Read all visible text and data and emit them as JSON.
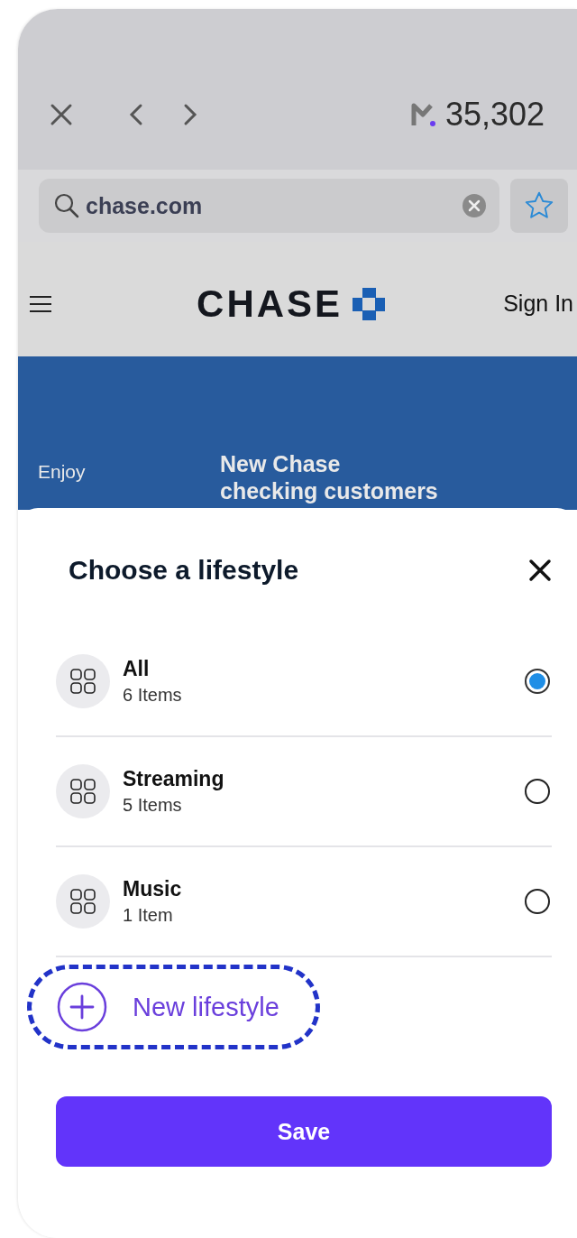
{
  "browser": {
    "points": "35,302",
    "address": "chase.com",
    "bookmarked": false
  },
  "site": {
    "logo": "CHASE",
    "sign_in": "Sign In",
    "hero": {
      "kicker": "Enjoy",
      "headline": "New Chase",
      "subline": "checking customers"
    }
  },
  "sheet": {
    "title": "Choose a lifestyle",
    "options": [
      {
        "name": "All",
        "count": "6 Items",
        "selected": true
      },
      {
        "name": "Streaming",
        "count": "5 Items",
        "selected": false
      },
      {
        "name": "Music",
        "count": "1 Item",
        "selected": false
      }
    ],
    "new_button": {
      "label": "New lifestyle",
      "highlighted": true
    },
    "save": "Save"
  }
}
